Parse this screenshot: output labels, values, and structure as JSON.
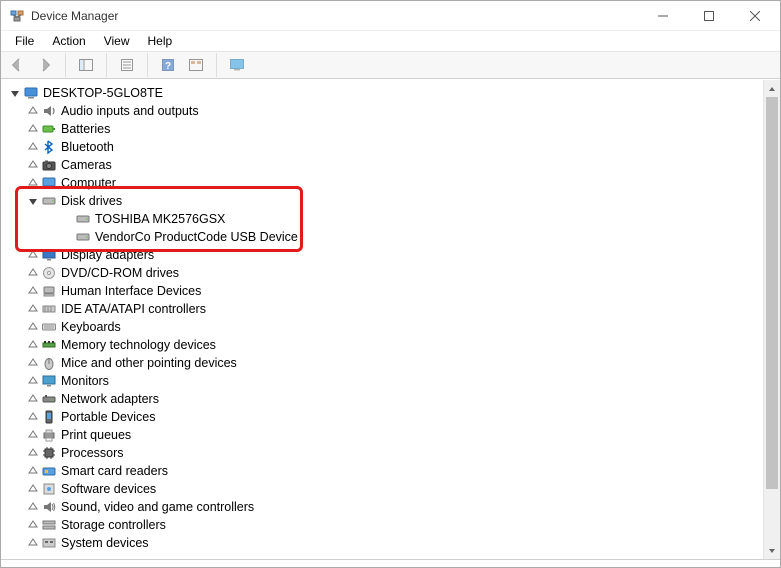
{
  "window": {
    "title": "Device Manager"
  },
  "menu": {
    "file": "File",
    "action": "Action",
    "view": "View",
    "help": "Help"
  },
  "tree": {
    "root": {
      "label": "DESKTOP-5GLO8TE"
    },
    "categories": [
      {
        "label": "Audio inputs and outputs",
        "icon": "audio"
      },
      {
        "label": "Batteries",
        "icon": "battery"
      },
      {
        "label": "Bluetooth",
        "icon": "bluetooth"
      },
      {
        "label": "Cameras",
        "icon": "camera"
      },
      {
        "label": "Computer",
        "icon": "computer"
      },
      {
        "label": "Disk drives",
        "icon": "disk",
        "expanded": true,
        "children": [
          {
            "label": "TOSHIBA MK2576GSX"
          },
          {
            "label": "VendorCo ProductCode USB Device"
          }
        ]
      },
      {
        "label": "Display adapters",
        "icon": "display"
      },
      {
        "label": "DVD/CD-ROM drives",
        "icon": "dvd"
      },
      {
        "label": "Human Interface Devices",
        "icon": "hid"
      },
      {
        "label": "IDE ATA/ATAPI controllers",
        "icon": "ide"
      },
      {
        "label": "Keyboards",
        "icon": "keyboard"
      },
      {
        "label": "Memory technology devices",
        "icon": "memory"
      },
      {
        "label": "Mice and other pointing devices",
        "icon": "mouse"
      },
      {
        "label": "Monitors",
        "icon": "monitor"
      },
      {
        "label": "Network adapters",
        "icon": "network"
      },
      {
        "label": "Portable Devices",
        "icon": "portable"
      },
      {
        "label": "Print queues",
        "icon": "printer"
      },
      {
        "label": "Processors",
        "icon": "cpu"
      },
      {
        "label": "Smart card readers",
        "icon": "smartcard"
      },
      {
        "label": "Software devices",
        "icon": "software"
      },
      {
        "label": "Sound, video and game controllers",
        "icon": "sound"
      },
      {
        "label": "Storage controllers",
        "icon": "storage"
      },
      {
        "label": "System devices",
        "icon": "system"
      }
    ]
  },
  "highlight": {
    "category_index": 5
  }
}
